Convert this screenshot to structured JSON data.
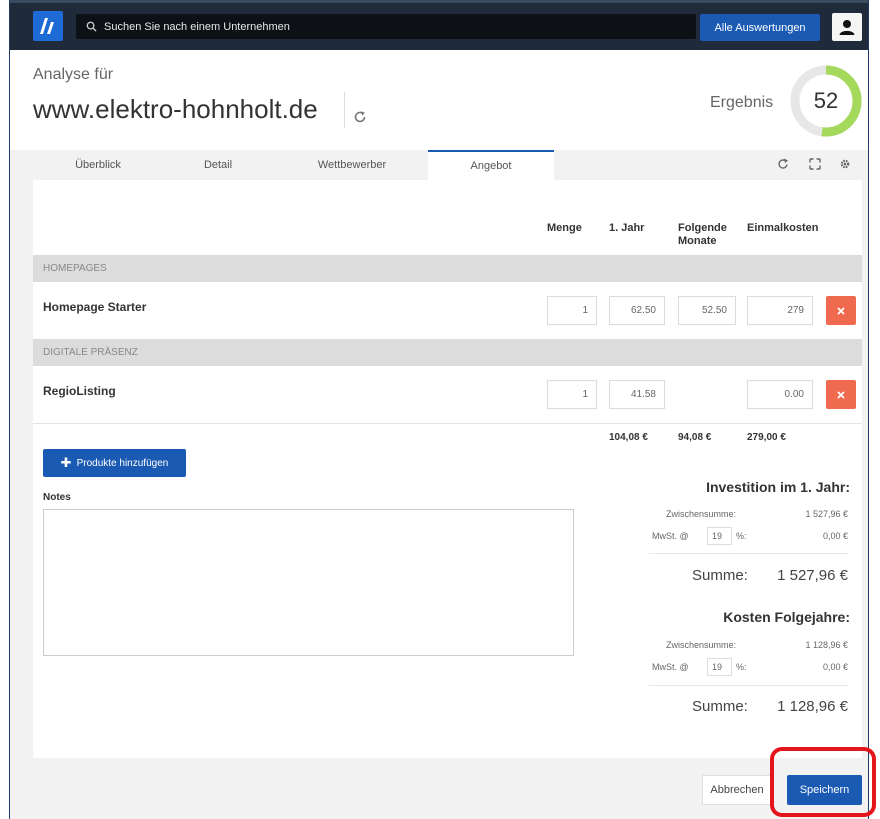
{
  "topbar": {
    "search_placeholder": "Suchen Sie nach einem Unternehmen",
    "reports_label": "Alle Auswertungen",
    "colors": {
      "bar": "#1f2b3a",
      "accent": "#1b5ab3"
    }
  },
  "header": {
    "analysis_label": "Analyse für",
    "domain": "www.elektro-hohnholt.de",
    "score_label": "Ergebnis",
    "score": "52",
    "score_fraction": 0.52,
    "gauge_color": "#a5d95b"
  },
  "tabs": [
    {
      "label": "Überblick",
      "active": false
    },
    {
      "label": "Detail",
      "active": false
    },
    {
      "label": "Wettbewerber",
      "active": false
    },
    {
      "label": "Angebot",
      "active": true
    }
  ],
  "tab_tools": [
    "share-icon",
    "expand-icon",
    "gear-icon"
  ],
  "table": {
    "columns": [
      "Menge",
      "1. Jahr",
      "Folgende Monate",
      "Einmalkosten"
    ],
    "sections": [
      {
        "title": "HOMEPAGES",
        "products": [
          {
            "name": "Homepage Starter",
            "qty": "1",
            "year1": "62.50",
            "monthly": "52.50",
            "onetime": "279"
          }
        ]
      },
      {
        "title": "DIGITALE PRÄSENZ",
        "products": [
          {
            "name": "RegioListing",
            "qty": "1",
            "year1": "41.58",
            "monthly": "",
            "onetime": "0.00"
          }
        ]
      }
    ],
    "totals": {
      "year1": "104,08 €",
      "monthly": "94,08 €",
      "onetime": "279,00 €"
    }
  },
  "add_products_label": "Produkte hinzufügen",
  "notes_label": "Notes",
  "investment": {
    "title": "Investition im 1. Jahr:",
    "subtotal_label": "Zwischensumme:",
    "subtotal": "1 527,96 €",
    "vat_prefix": "MwSt. @",
    "vat_rate": "19",
    "vat_suffix": "%:",
    "vat_amount": "0,00 €",
    "sum_label": "Summe:",
    "sum": "1 527,96 €"
  },
  "followup": {
    "title": "Kosten Folgejahre:",
    "subtotal_label": "Zwischensumme:",
    "subtotal": "1 128,96 €",
    "vat_prefix": "MwSt. @",
    "vat_rate": "19",
    "vat_suffix": "%:",
    "vat_amount": "0,00 €",
    "sum_label": "Summe:",
    "sum": "1 128,96 €"
  },
  "footer": {
    "cancel_label": "Abbrechen",
    "save_label": "Speichern",
    "highlight_color": "#e5161b"
  }
}
